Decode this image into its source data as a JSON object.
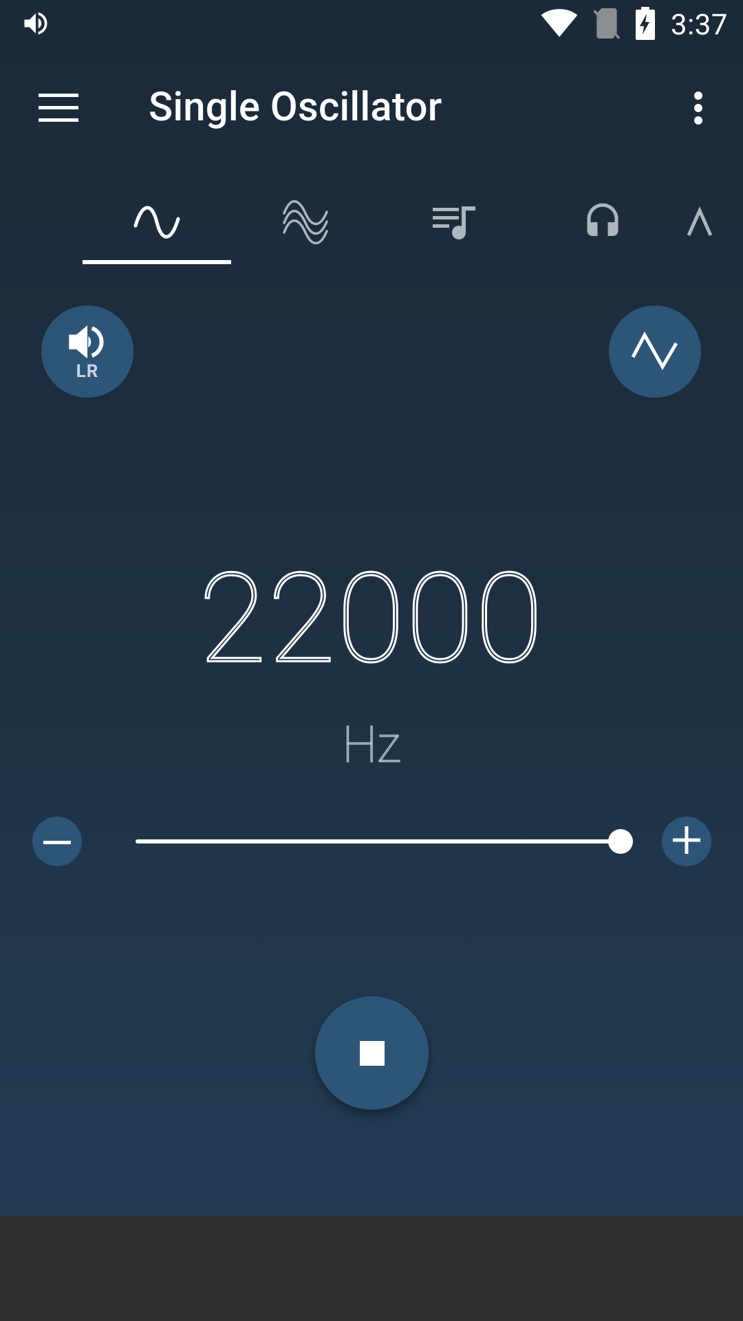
{
  "status_bar": {
    "time": "3:37",
    "icons": [
      "volume-icon",
      "wifi-icon",
      "no-sim-icon",
      "battery-charging-icon"
    ]
  },
  "toolbar": {
    "title": "Single Oscillator",
    "menu_icon": "hamburger-menu-icon",
    "overflow_icon": "more-vertical-icon"
  },
  "tabs": [
    {
      "icon": "sine-wave-icon",
      "selected": true
    },
    {
      "icon": "multi-wave-icon",
      "selected": false
    },
    {
      "icon": "playlist-music-icon",
      "selected": false
    },
    {
      "icon": "headphones-icon",
      "selected": false
    },
    {
      "icon": "partial-wave-icon",
      "selected": false
    }
  ],
  "controls": {
    "channel_label": "LR",
    "channel_icon": "speaker-lr-icon",
    "waveform_icon": "triangle-wave-icon"
  },
  "frequency": {
    "value": "22000",
    "unit": "Hz"
  },
  "slider": {
    "position": 1.0
  },
  "playback": {
    "stop_icon": "stop-icon"
  },
  "colors": {
    "accent": "#2d5577",
    "background_top": "#1b2a38",
    "background_bottom": "#223c54",
    "nav_bar": "#303030"
  }
}
